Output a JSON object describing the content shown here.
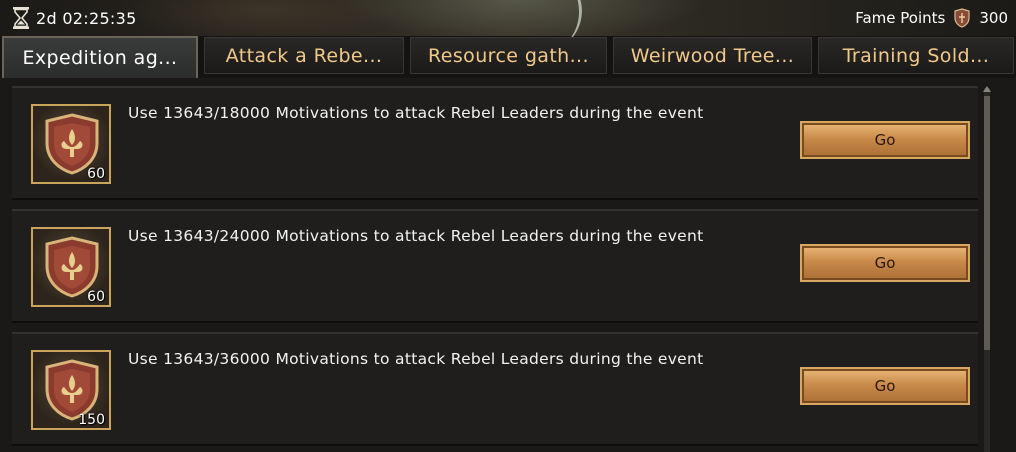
{
  "header": {
    "timer": "2d 02:25:35",
    "fame_label": "Fame Points",
    "fame_value": "300"
  },
  "tabs": [
    {
      "label": "Expedition ag...",
      "active": true
    },
    {
      "label": "Attack a Rebe...",
      "active": false
    },
    {
      "label": "Resource gath...",
      "active": false
    },
    {
      "label": "Weirwood Tree...",
      "active": false
    },
    {
      "label": "Training Sold...",
      "active": false
    }
  ],
  "tasks": [
    {
      "description": "Use 13643/18000 Motivations to attack Rebel Leaders during the event",
      "reward_count": "60",
      "button": "Go"
    },
    {
      "description": "Use 13643/24000 Motivations to attack Rebel Leaders during the event",
      "reward_count": "60",
      "button": "Go"
    },
    {
      "description": "Use 13643/36000 Motivations to attack Rebel Leaders during the event",
      "reward_count": "150",
      "button": "Go"
    }
  ],
  "icons": {
    "timer": "hourglass-icon",
    "fame": "fame-shield-icon",
    "reward": "fleur-de-lis-shield-icon"
  },
  "colors": {
    "tab_text": "#f0c98a",
    "button_gold": "#c98b4a",
    "frame_gold": "#c9a45a"
  }
}
